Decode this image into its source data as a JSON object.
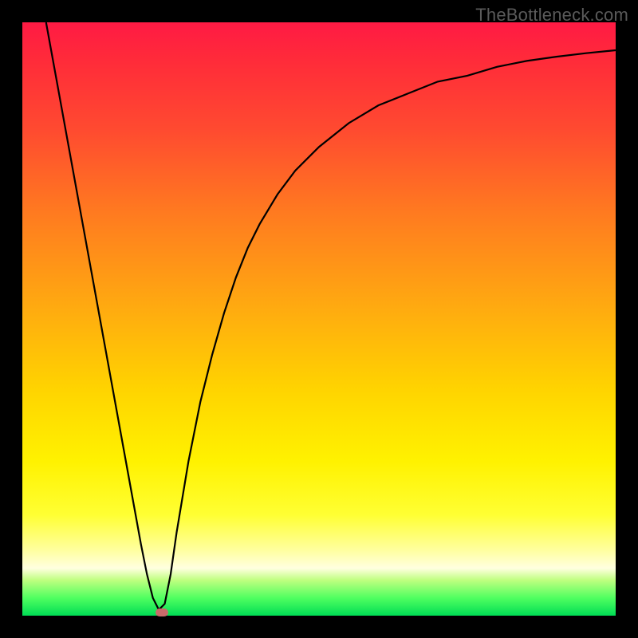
{
  "watermark": "TheBottleneck.com",
  "chart_data": {
    "type": "line",
    "title": "",
    "xlabel": "",
    "ylabel": "",
    "xlim": [
      0,
      100
    ],
    "ylim": [
      0,
      100
    ],
    "x": [
      4,
      6,
      8,
      10,
      12,
      14,
      16,
      18,
      20,
      21,
      22,
      23,
      24,
      25,
      26,
      28,
      30,
      32,
      34,
      36,
      38,
      40,
      43,
      46,
      50,
      55,
      60,
      65,
      70,
      75,
      80,
      85,
      90,
      95,
      100
    ],
    "values": [
      100,
      89,
      78,
      67,
      56,
      45,
      34,
      23,
      12,
      7,
      3,
      1,
      2,
      7,
      14,
      26,
      36,
      44,
      51,
      57,
      62,
      66,
      71,
      75,
      79,
      83,
      86,
      88,
      90,
      91,
      92.5,
      93.5,
      94.2,
      94.8,
      95.3
    ],
    "marker_point": {
      "x": 23.5,
      "y": 0.6
    },
    "background_gradient": {
      "top": "#ff1a44",
      "mid": "#ffd400",
      "bottom": "#00dd55"
    },
    "curve_color": "#000000",
    "marker_color": "#c96a6a"
  }
}
